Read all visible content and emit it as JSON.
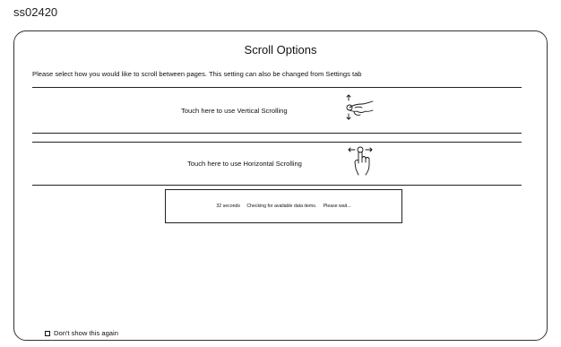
{
  "screen_id": "ss02420",
  "dialog": {
    "title": "Scroll Options",
    "instruction": "Please select how you would like to scroll between pages. This setting can also be changed from Settings tab",
    "options": [
      {
        "label": "Touch here to use Vertical Scrolling",
        "icon": "vertical-scroll-hand-icon"
      },
      {
        "label": "Touch here to use Horizontal Scrolling",
        "icon": "horizontal-scroll-hand-icon"
      }
    ],
    "status": {
      "seconds": "32 seconds",
      "message": "Checking for available data items.",
      "wait": "Please wait..."
    },
    "dont_show_label": "Don't show this again"
  }
}
